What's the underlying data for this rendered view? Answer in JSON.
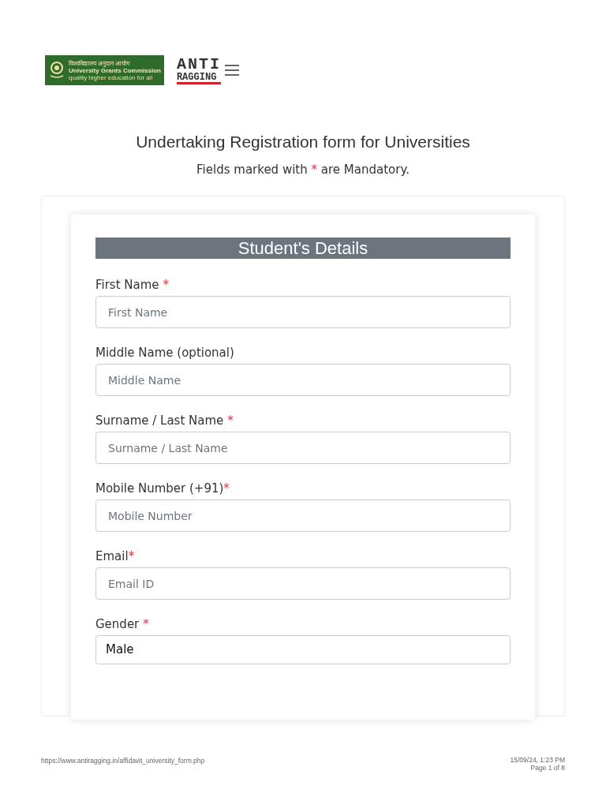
{
  "header": {
    "ugc_logo": {
      "hindi": "विश्वविद्यालय अनुदान आयोग",
      "name": "University Grants Commission",
      "tagline": "quality higher education for all"
    },
    "anti_ragging_logo": {
      "line_1": "ANTI",
      "line_2": "RAGGING"
    }
  },
  "title": "Undertaking Registration form for Universities",
  "subtitle": {
    "before": "Fields marked with",
    "mark": "*",
    "after": "are Mandatory."
  },
  "section_title": "Student's Details",
  "fields": [
    {
      "kind": "input",
      "label": "First Name",
      "required": true,
      "mark_gap": true,
      "placeholder": "First Name"
    },
    {
      "kind": "input",
      "label": "Middle Name (optional)",
      "required": false,
      "placeholder": "Middle Name"
    },
    {
      "kind": "input",
      "label": "Surname / Last Name",
      "required": true,
      "mark_gap": true,
      "placeholder": "Surname / Last Name"
    },
    {
      "kind": "input",
      "label": "Mobile Number (+91)",
      "required": true,
      "mark_gap": false,
      "placeholder": "Mobile Number"
    },
    {
      "kind": "input",
      "label": "Email",
      "required": true,
      "mark_gap": false,
      "placeholder": "Email ID"
    },
    {
      "kind": "select",
      "label": "Gender",
      "required": true,
      "mark_gap": true,
      "value": "Male"
    }
  ],
  "footer": {
    "url": "https://www.antiragging.in/affidavit_university_form.php",
    "date": "15/09/24, 1:23 PM",
    "page": "Page 1 of 8"
  }
}
